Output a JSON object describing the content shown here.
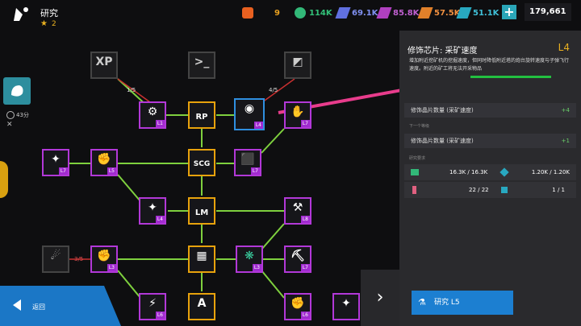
{
  "header": {
    "title": "研究",
    "stars": "2"
  },
  "resources": [
    {
      "name": "gem-red",
      "value": "9",
      "color": "#e86020"
    },
    {
      "name": "green-crystal",
      "value": "114K",
      "color": "#32b878"
    },
    {
      "name": "blue-crystal",
      "value": "69.1K",
      "color": "#6070e0"
    },
    {
      "name": "purple-crystal",
      "value": "85.8K",
      "color": "#b040c0"
    },
    {
      "name": "orange-crystal",
      "value": "57.5K",
      "color": "#e0802a"
    },
    {
      "name": "cyan-crystal",
      "value": "51.1K",
      "color": "#28a8c0"
    }
  ],
  "credits": "179,661",
  "side": {
    "time_label": "43分"
  },
  "tree": {
    "frac_left": "1/5",
    "frac_right": "4/5",
    "frac_bottom": "3/5",
    "nodes": [
      {
        "name": "node-xp",
        "glyph": "XP",
        "lvl": ""
      },
      {
        "name": "node-terminal",
        "glyph": ">_",
        "lvl": ""
      },
      {
        "name": "node-topright",
        "glyph": "◩",
        "lvl": ""
      },
      {
        "name": "node-l1-a",
        "glyph": "⚙",
        "lvl": "L1"
      },
      {
        "name": "node-rp",
        "glyph": "RP",
        "lvl": ""
      },
      {
        "name": "node-selected",
        "glyph": "◉",
        "lvl": "L4"
      },
      {
        "name": "node-l7-a",
        "glyph": "✋",
        "lvl": "L7"
      },
      {
        "name": "node-l7-b",
        "glyph": "✦",
        "lvl": "L7"
      },
      {
        "name": "node-l5-a",
        "glyph": "✊",
        "lvl": "L5"
      },
      {
        "name": "node-scg",
        "glyph": "SCG",
        "lvl": ""
      },
      {
        "name": "node-l7-c",
        "glyph": "⬛",
        "lvl": "L7"
      },
      {
        "name": "node-l4-b",
        "glyph": "✦",
        "lvl": "L4"
      },
      {
        "name": "node-lm",
        "glyph": "LM",
        "lvl": ""
      },
      {
        "name": "node-l8",
        "glyph": "⚒",
        "lvl": "L8"
      },
      {
        "name": "node-grey-left",
        "glyph": "☄",
        "lvl": ""
      },
      {
        "name": "node-l3-a",
        "glyph": "✊",
        "lvl": "L3"
      },
      {
        "name": "node-shield",
        "glyph": "▦",
        "lvl": ""
      },
      {
        "name": "node-l3-b",
        "glyph": "❋",
        "lvl": "L3"
      },
      {
        "name": "node-l7-d",
        "glyph": "⛏",
        "lvl": "L7"
      },
      {
        "name": "node-l6-a",
        "glyph": "⚡",
        "lvl": "L6"
      },
      {
        "name": "node-a",
        "glyph": "A",
        "lvl": ""
      },
      {
        "name": "node-l6-b",
        "glyph": "✊",
        "lvl": "L6"
      },
      {
        "name": "node-l6-c",
        "glyph": "✦",
        "lvl": ""
      }
    ]
  },
  "panel": {
    "title": "修饰芯片: 采矿速度",
    "level": "L4",
    "description": "增加附近挖矿机的挖掘速度，但同时降低附近塔的炮台旋转速度与子弹飞行速度。附近的矿工将无法开采物品",
    "stat_label": "修饰晶片数量 (采矿速度)",
    "stat_value": "+4",
    "next_level_label": "下一个等级",
    "next_stat_label": "修饰晶片数量 (采矿速度)",
    "next_stat_value": "+1",
    "requirements_label": "研究要求",
    "req": [
      {
        "left": "16.3K / 16.3K",
        "right": "1.20K / 1.20K"
      },
      {
        "left": "22 / 22",
        "right": "1 / 1"
      }
    ],
    "research_button": "研究 L5"
  },
  "back_label": "返回"
}
